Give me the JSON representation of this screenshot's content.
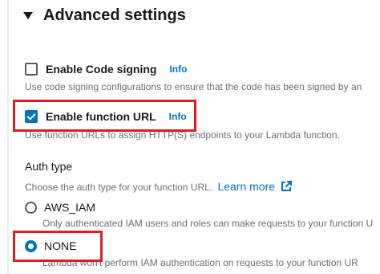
{
  "section": {
    "title": "Advanced settings",
    "expand_icon": "caret-down-icon"
  },
  "code_signing": {
    "label": "Enable Code signing",
    "checked": false,
    "info": "Info",
    "description": "Use code signing configurations to ensure that the code has been signed by an"
  },
  "function_url": {
    "label": "Enable function URL",
    "checked": true,
    "info": "Info",
    "description": "Use function URLs to assign HTTP(S) endpoints to your Lambda function."
  },
  "auth_type": {
    "label": "Auth type",
    "description": "Choose the auth type for your function URL.",
    "learn_more": "Learn more",
    "learn_more_icon": "external-link-icon",
    "options": [
      {
        "label": "AWS_IAM",
        "description": "Only authenticated IAM users and roles can make requests to your function U",
        "selected": false
      },
      {
        "label": "NONE",
        "description": "Lambda won't perform IAM authentication on requests to your function UR",
        "selected": true
      }
    ]
  },
  "colors": {
    "accent": "#0073bb",
    "highlight_box": "#e01b24",
    "text": "#16191f",
    "muted_text": "#687078"
  }
}
